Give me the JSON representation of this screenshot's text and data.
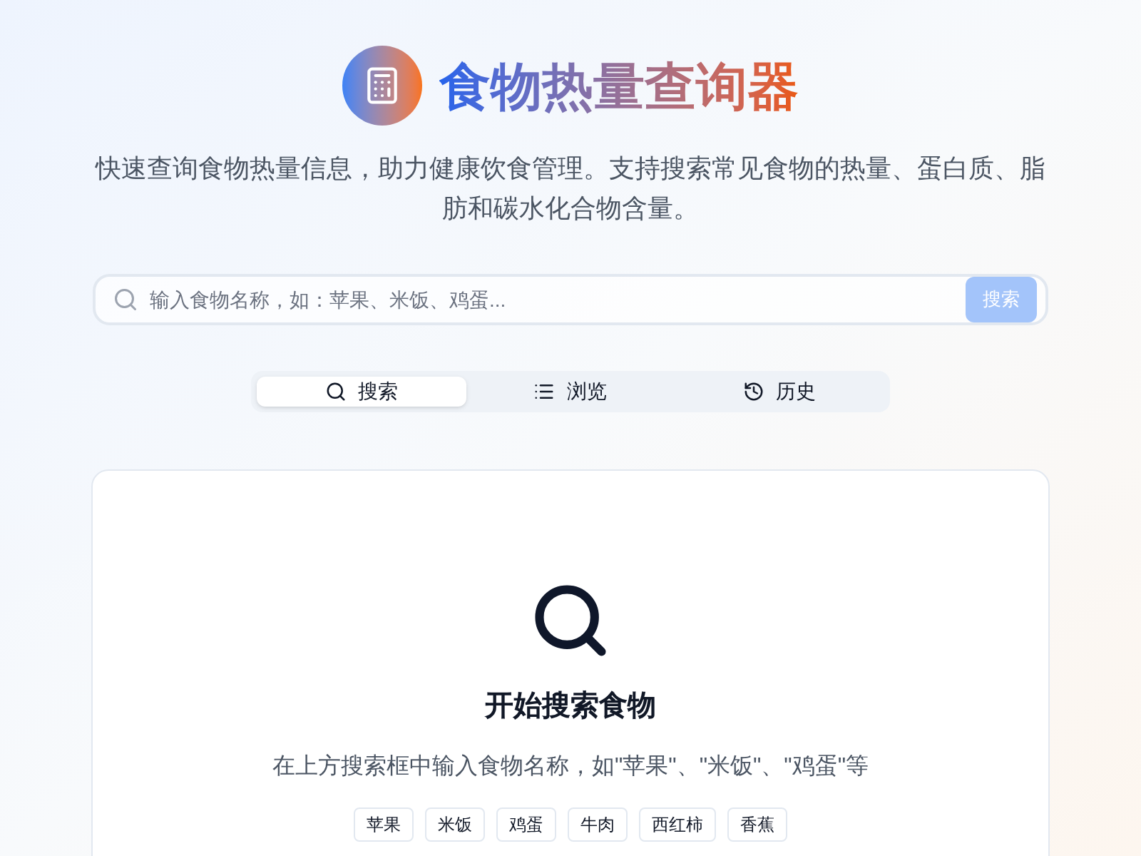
{
  "header": {
    "title": "食物热量查询器",
    "subtitle": "快速查询食物热量信息，助力健康饮食管理。支持搜索常见食物的热量、蛋白质、脂肪和碳水化合物含量。"
  },
  "search": {
    "placeholder": "输入食物名称，如：苹果、米饭、鸡蛋...",
    "button": "搜索",
    "disabled": true
  },
  "tabs": [
    {
      "label": "搜索",
      "kind": "search",
      "selected": true
    },
    {
      "label": "浏览",
      "kind": "list",
      "selected": false
    },
    {
      "label": "历史",
      "kind": "history",
      "selected": false
    }
  ],
  "empty_state": {
    "title": "开始搜索食物",
    "hint": "在上方搜索框中输入食物名称，如\"苹果\"、\"米饭\"、\"鸡蛋\"等",
    "suggestions": [
      "苹果",
      "米饭",
      "鸡蛋",
      "牛肉",
      "西红柿",
      "香蕉"
    ]
  }
}
